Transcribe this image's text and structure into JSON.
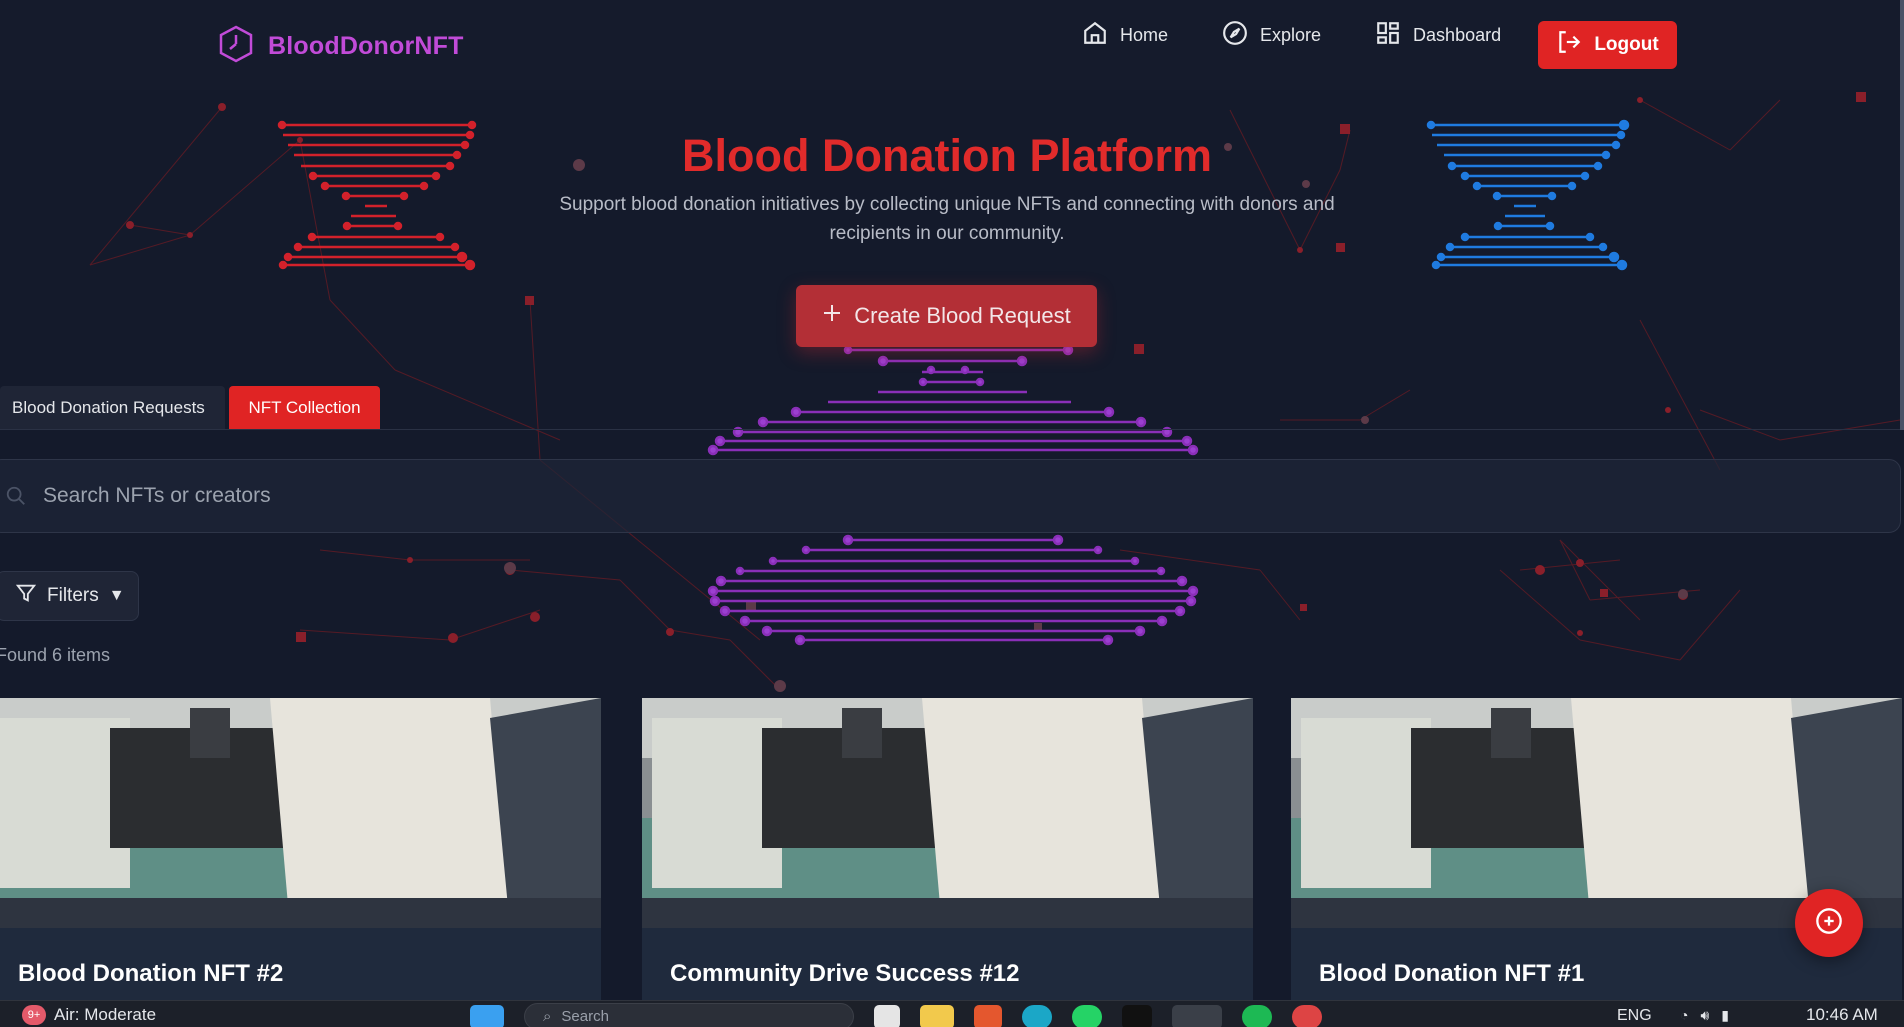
{
  "brand": {
    "name": "BloodDonorNFT",
    "logo_icon": "clock-hexagon-icon",
    "color": "#c14bd8"
  },
  "nav": {
    "items": [
      {
        "label": "Home",
        "icon": "home-icon"
      },
      {
        "label": "Explore",
        "icon": "compass-icon"
      },
      {
        "label": "Dashboard",
        "icon": "dashboard-grid-icon"
      }
    ],
    "logout_label": "Logout"
  },
  "hero": {
    "title": "Blood Donation Platform",
    "subtitle": "Support blood donation initiatives by collecting unique NFTs and connecting with donors and recipients in our community.",
    "create_button": "Create Blood Request"
  },
  "tabs": [
    {
      "label": "Blood Donation Requests",
      "active": false
    },
    {
      "label": "NFT Collection",
      "active": true
    }
  ],
  "search": {
    "placeholder": "Search NFTs or creators",
    "value": ""
  },
  "filters": {
    "label": "Filters"
  },
  "results": {
    "found_text": "Found 6 items"
  },
  "cards": [
    {
      "title": "Blood Donation NFT #2"
    },
    {
      "title": "Community Drive Success #12"
    },
    {
      "title": "Blood Donation NFT #1"
    }
  ],
  "colors": {
    "accent": "#e02424",
    "background": "#141a2b",
    "card": "#1f2a3d",
    "title_red": "#e12b2b"
  },
  "taskbar": {
    "badge": "9+",
    "weather": "Air: Moderate",
    "search_placeholder": "Search",
    "language": "ENG",
    "time": "10:46 AM"
  }
}
